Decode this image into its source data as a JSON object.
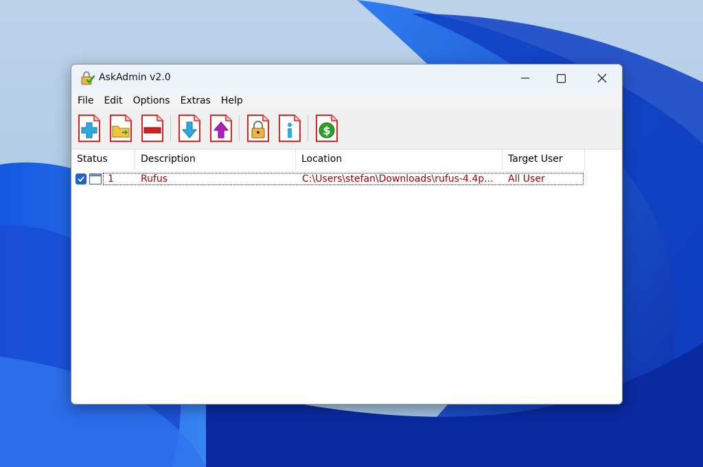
{
  "window": {
    "title": "AskAdmin v2.0"
  },
  "menu": [
    "File",
    "Edit",
    "Options",
    "Extras",
    "Help"
  ],
  "toolbar_icons": [
    "add-icon",
    "add-folder-icon",
    "remove-icon",
    "move-down-icon",
    "move-up-icon",
    "lock-icon",
    "info-icon",
    "donate-icon"
  ],
  "list": {
    "columns": [
      "Status",
      "Description",
      "Location",
      "Target User"
    ],
    "rows": [
      {
        "checked": true,
        "index": "1",
        "description": "Rufus",
        "location": "C:\\Users\\stefan\\Downloads\\rufus-4.4p...",
        "target_user": "All User"
      }
    ]
  },
  "colors": {
    "row_text": "#a30000",
    "accent": "#1e63c7"
  }
}
